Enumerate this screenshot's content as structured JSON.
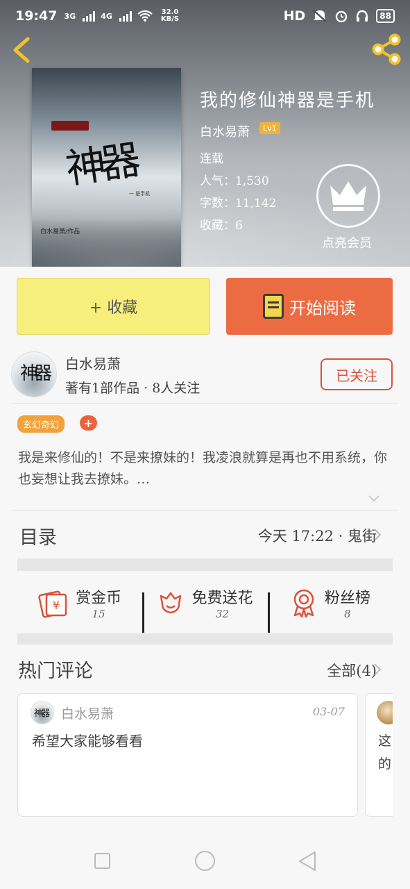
{
  "status_bar": {
    "time": "19:47",
    "net1": "3G",
    "net2": "4G",
    "speed_value": "32.0",
    "speed_unit": "KB/S",
    "hd": "HD",
    "battery": "88"
  },
  "book": {
    "title": "我的修仙神器是手机",
    "author": "白水易萧",
    "level": "Lv1",
    "status": "连载",
    "popularity": "人气：1,530",
    "word_count": "字数：11,142",
    "favorites": "收藏：6",
    "cover_title": "神器",
    "cover_sub": "一 是手机",
    "cover_author": "白水易萧/作品"
  },
  "vip": {
    "label": "点亮会员"
  },
  "actions": {
    "collect_label": "+ 收藏",
    "read_label": "开始阅读"
  },
  "author_row": {
    "avatar_text": "神器",
    "name": "白水易萧",
    "info": "著有1部作品 · 8人关注",
    "follow_label": "已关注"
  },
  "tags": {
    "genre": "玄幻奇幻",
    "add": "+"
  },
  "description": "我是来修仙的！不是来撩妹的！我凌浪就算是再也不用系统，你也妄想让我去撩妹。…",
  "catalog": {
    "label": "目录",
    "latest": "今天 17:22 · 鬼街"
  },
  "stats": [
    {
      "label": "赏金币",
      "value": "15"
    },
    {
      "label": "免费送花",
      "value": "32"
    },
    {
      "label": "粉丝榜",
      "value": "8"
    }
  ],
  "hot_comments": {
    "label": "热门评论",
    "all_label": "全部(4)",
    "items": [
      {
        "avatar_text": "神器",
        "name": "白水易萧",
        "date": "03-07",
        "text": "希望大家能够看看"
      },
      {
        "text_line1": "这",
        "text_line2": "的"
      }
    ]
  },
  "colors": {
    "collect_bg": "#f7ef7c",
    "read_bg": "#eb6c43",
    "accent_red": "#d9533c",
    "tag_orange": "#f1a23a",
    "level_badge": "#f1b23a"
  }
}
